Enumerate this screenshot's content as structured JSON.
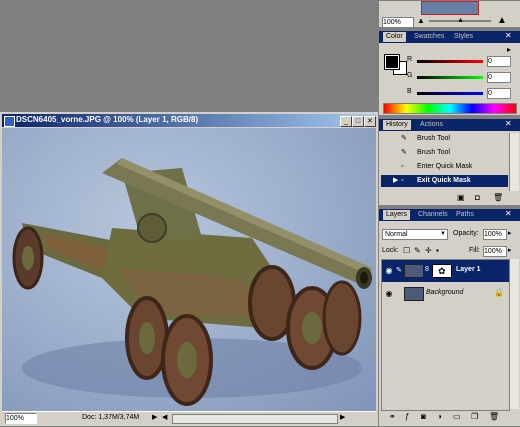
{
  "navigator": {
    "zoom": "100%"
  },
  "color_panel": {
    "tabs": [
      "Color",
      "Swatches",
      "Styles"
    ],
    "channels": [
      {
        "label": "R",
        "value": "0",
        "color": "#d00000"
      },
      {
        "label": "G",
        "value": "0",
        "color": "#00a000"
      },
      {
        "label": "B",
        "value": "0",
        "color": "#0000d0"
      }
    ]
  },
  "history_panel": {
    "tabs": [
      "History",
      "Actions"
    ],
    "items": [
      "Brush Tool",
      "Brush Tool",
      "Enter Quick Mask",
      "Exit Quick Mask"
    ],
    "selected_index": 3
  },
  "layers_panel": {
    "tabs": [
      "Layers",
      "Channels",
      "Paths"
    ],
    "blend_mode": "Normal",
    "opacity_label": "Opacity:",
    "opacity_value": "100%",
    "lock_label": "Lock:",
    "fill_label": "Fill:",
    "fill_value": "100%",
    "layers": [
      {
        "name": "Layer 1",
        "selected": true
      },
      {
        "name": "Background",
        "selected": false
      }
    ]
  },
  "document": {
    "title": "DSCN6405_vorne.JPG @ 100% (Layer 1, RGB/8)",
    "zoom": "100%",
    "doc_info": "Doc: 1,37M/3,74M"
  }
}
